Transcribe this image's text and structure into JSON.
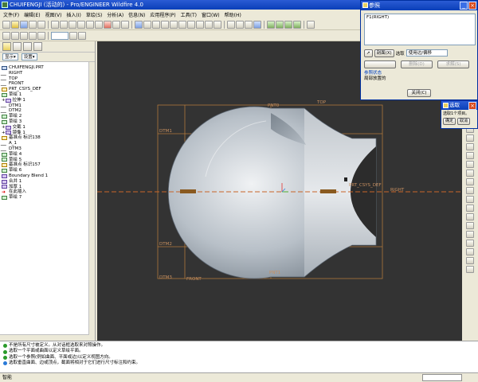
{
  "window": {
    "title": "CHUIFENGJI (活动的) - Pro/ENGINEER Wildfire 4.0",
    "min": "_",
    "max": "□",
    "close": "×"
  },
  "menu": [
    "文件(F)",
    "编辑(E)",
    "视图(V)",
    "插入(I)",
    "草绘(S)",
    "分析(A)",
    "信息(N)",
    "应用程序(P)",
    "工具(T)",
    "窗口(W)",
    "帮助(H)"
  ],
  "left_panel": {
    "show_label": "显示▾",
    "settings_label": "设置▾",
    "tree": [
      {
        "label": "CHUIFENGJI.PRT",
        "icon": "part-icon",
        "expander": ""
      },
      {
        "label": "RIGHT",
        "icon": "datum-plane-icon",
        "expander": ""
      },
      {
        "label": "TOP",
        "icon": "datum-plane-icon",
        "expander": ""
      },
      {
        "label": "FRONT",
        "icon": "datum-plane-icon",
        "expander": ""
      },
      {
        "label": "PRT_CSYS_DEF",
        "icon": "csys-icon",
        "expander": ""
      },
      {
        "label": "草绘 1",
        "icon": "sketch-icon",
        "expander": ""
      },
      {
        "label": "拉伸 1",
        "icon": "extrude-icon",
        "expander": "+"
      },
      {
        "label": "DTM1",
        "icon": "datum-plane-icon",
        "expander": ""
      },
      {
        "label": "DTM2",
        "icon": "datum-plane-icon",
        "expander": ""
      },
      {
        "label": "草绘 2",
        "icon": "sketch-icon",
        "expander": ""
      },
      {
        "label": "草绘 3",
        "icon": "sketch-icon",
        "expander": ""
      },
      {
        "label": "交截 1",
        "icon": "intersect-icon",
        "expander": "+"
      },
      {
        "label": "镜像 1",
        "icon": "mirror-icon",
        "expander": "+"
      },
      {
        "label": "基准点 标识138",
        "icon": "datum-point-icon",
        "expander": ""
      },
      {
        "label": "A_1",
        "icon": "datum-axis-icon",
        "expander": ""
      },
      {
        "label": "DTM3",
        "icon": "datum-plane-icon",
        "expander": ""
      },
      {
        "label": "草绘 4",
        "icon": "sketch-icon",
        "expander": ""
      },
      {
        "label": "草绘 5",
        "icon": "sketch-icon",
        "expander": ""
      },
      {
        "label": "基准点 标识157",
        "icon": "datum-point-icon",
        "expander": ""
      },
      {
        "label": "草绘 6",
        "icon": "sketch-icon",
        "expander": ""
      },
      {
        "label": "Boundary Blend 1",
        "icon": "blend-icon",
        "expander": ""
      },
      {
        "label": "合并 1",
        "icon": "merge-icon",
        "expander": ""
      },
      {
        "label": "加厚 1",
        "icon": "thicken-icon",
        "expander": ""
      },
      {
        "label": "在此插入",
        "icon": "insert-here-icon",
        "expander": ""
      },
      {
        "label": "草绘 7",
        "icon": "sketch-icon",
        "expander": ""
      }
    ]
  },
  "viewport": {
    "datum_labels": {
      "top": "TOP",
      "front": "FRONT",
      "right": "RIGHT",
      "dtm1": "DTM1",
      "dtm2": "DTM2",
      "dtm3": "DTM3",
      "csys": "PRT_CSYS_DEF",
      "pnt0": "PNT0",
      "pnt1": "PNT1"
    }
  },
  "messages": [
    {
      "type": "ok",
      "text": "不是所有尺寸被定义。从对话框选取来对照操作。"
    },
    {
      "type": "ok",
      "text": "选取一个平面或曲面以定义草绘平面。"
    },
    {
      "type": "ok",
      "text": "选取一个参照(例如曲面、平面或边)以定义视图方向。"
    },
    {
      "type": "info",
      "text": "选取垂直曲面、边或顶点，截面将相对于它们进行尺寸标注和约束。"
    }
  ],
  "statusbar": {
    "text": "智能"
  },
  "ref_dialog": {
    "title": "参照",
    "list": [
      "F1(RIGHT)"
    ],
    "select_btn": "剖面(X)",
    "filter_label": "选取",
    "filter_value": "使用边/偏移",
    "delete_btn": "删除(D)",
    "solve_btn": "求解(S)",
    "status_label": "参照状态",
    "status_value": "局部放置的",
    "close_btn": "关闭(C)"
  },
  "select_dialog": {
    "title": "选取",
    "message": "选取1个项目。",
    "ok": "确定",
    "cancel": "取消"
  },
  "colors": {
    "viewport_bg": "#333333",
    "datum": "#b0783c",
    "center_line": "#c86428",
    "titlebar": "#0a3fb8"
  }
}
